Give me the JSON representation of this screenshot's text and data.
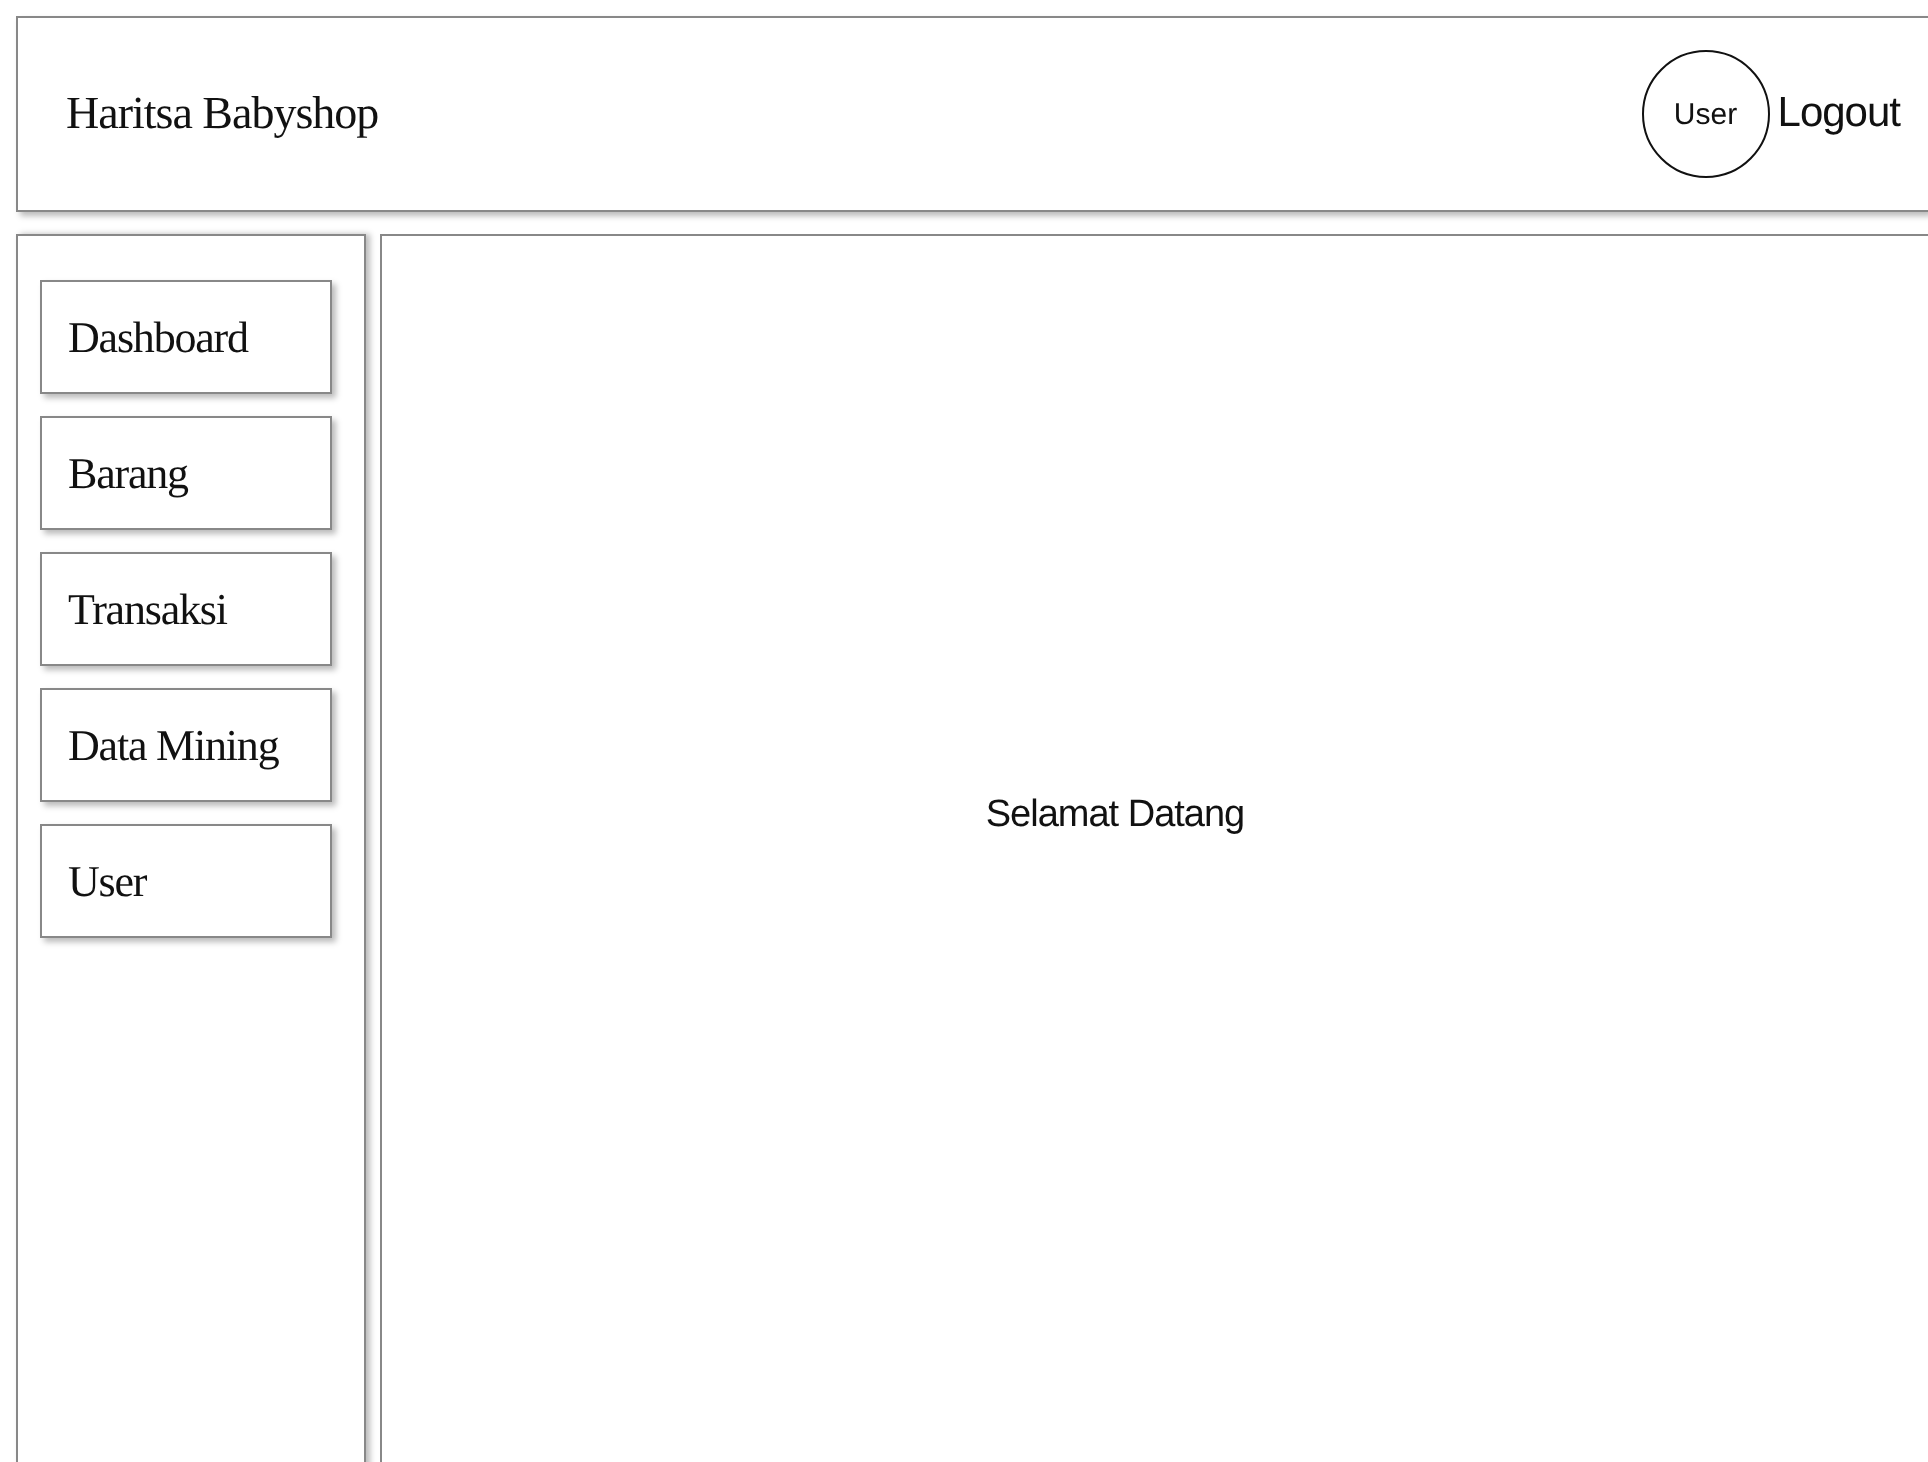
{
  "header": {
    "title": "Haritsa Babyshop",
    "avatar": "User",
    "logout": "Logout"
  },
  "sidebar": {
    "items": [
      {
        "label": "Dashboard"
      },
      {
        "label": "Barang"
      },
      {
        "label": "Transaksi"
      },
      {
        "label": "Data Mining"
      },
      {
        "label": "User"
      }
    ]
  },
  "main": {
    "message": "Selamat Datang"
  }
}
